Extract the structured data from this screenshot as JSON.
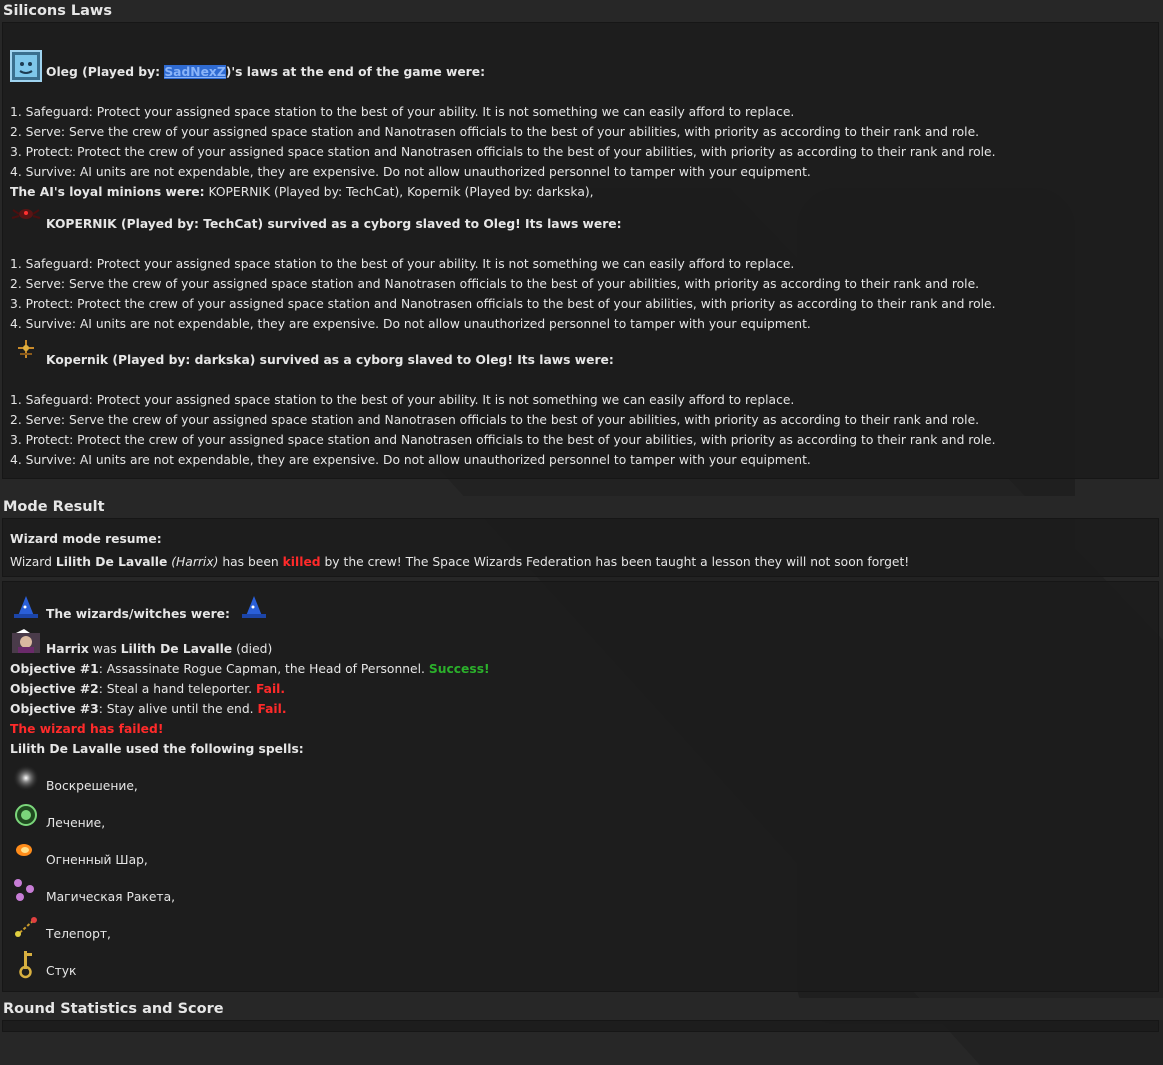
{
  "silicon": {
    "title": "Silicons Laws",
    "ai": {
      "pre": "Oleg (Played by: ",
      "player": "SadNexZ",
      "post": ")'s laws at the end of the game were:",
      "icon": "ai-core-icon"
    },
    "laws": [
      "1. Safeguard: Protect your assigned space station to the best of your ability. It is not something we can easily afford to replace.",
      "2. Serve: Serve the crew of your assigned space station and Nanotrasen officials to the best of your abilities, with priority as according to their rank and role.",
      "3. Protect: Protect the crew of your assigned space station and Nanotrasen officials to the best of your abilities, with priority as according to their rank and role.",
      "4. Survive: AI units are not expendable, they are expensive. Do not allow unauthorized personnel to tamper with your equipment."
    ],
    "minions_label": "The AI's loyal minions were:",
    "minions_list": " KOPERNIK (Played by: TechCat), Kopernik (Played by: darkska),",
    "cyborgs": [
      {
        "header": "KOPERNIK (Played by: TechCat) survived as a cyborg slaved to Oleg! Its laws were:",
        "icon": "spider-cyborg-icon"
      },
      {
        "header": "Kopernik (Played by: darkska) survived as a cyborg slaved to Oleg! Its laws were:",
        "icon": "drone-cyborg-icon"
      }
    ]
  },
  "mode": {
    "title": "Mode Result",
    "resume_label": "Wizard mode resume:",
    "summary": {
      "p1": "Wizard ",
      "name": "Lilith De Lavalle",
      "p2": " ",
      "player": "(Harrix)",
      "p3": " has been ",
      "killed": "killed",
      "p4": " by the crew! The Space Wizards Federation has been taught a lesson they will not soon forget!"
    },
    "wizards_header": "The wizards/witches were:",
    "wizard_line": {
      "player": "Harrix",
      "was": " was ",
      "char": "Lilith De Lavalle",
      "state": " (died)"
    },
    "objectives": [
      {
        "label": "Objective #1",
        "text": ": Assassinate Rogue Capman, the Head of Personnel. ",
        "result": "Success!",
        "ok": true
      },
      {
        "label": "Objective #2",
        "text": ": Steal a hand teleporter. ",
        "result": "Fail.",
        "ok": false
      },
      {
        "label": "Objective #3",
        "text": ": Stay alive until the end. ",
        "result": "Fail.",
        "ok": false
      }
    ],
    "failed": "The wizard has failed!",
    "spells_label": "Lilith De Lavalle used the following spells:",
    "spells": [
      {
        "name": "Воскрешение,",
        "icon": "resurrection-orb-icon"
      },
      {
        "name": "Лечение,",
        "icon": "healing-orb-icon"
      },
      {
        "name": "Огненный Шар,",
        "icon": "fireball-icon"
      },
      {
        "name": "Магическая Ракета,",
        "icon": "magic-missile-icon"
      },
      {
        "name": "Телепорт,",
        "icon": "teleport-icon"
      },
      {
        "name": "Стук",
        "icon": "knock-key-icon"
      }
    ]
  },
  "stats": {
    "title": "Round Statistics and Score"
  },
  "colors": {
    "background": "#272727",
    "panel": "#1c1c1c",
    "fail": "#ff2a2a",
    "success": "#2bb02b",
    "highlight": "#2f6bd2"
  }
}
